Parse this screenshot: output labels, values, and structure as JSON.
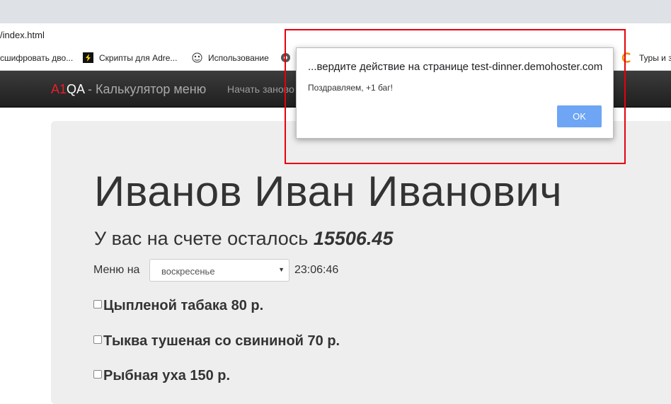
{
  "browser": {
    "url": "/index.html",
    "bookmarks": [
      {
        "label": "сшифровать дво..."
      },
      {
        "label": "Скрипты для Adre..."
      },
      {
        "label": "Использование"
      },
      {
        "label": "Туры и з"
      }
    ]
  },
  "navbar": {
    "brand_a1": "A1",
    "brand_qa": "QA",
    "brand_rest": " - Калькулятор меню",
    "link": "Начать заново"
  },
  "page": {
    "name": "Иванов Иван Иванович",
    "balance_label": "У вас на счете осталось ",
    "balance_value": "15506.45",
    "menu_label": "Меню на",
    "day_selected": "воскресенье",
    "clock": "23:06:46",
    "items": [
      {
        "label": "Цыпленой табака 80 р."
      },
      {
        "label": "Тыква тушеная со свининой 70 р."
      },
      {
        "label": "Рыбная уха 150 р."
      }
    ]
  },
  "dialog": {
    "title": "...вердите действие на странице test-dinner.demohoster.com",
    "message": "Поздравляем, +1 баг!",
    "ok_label": "OK"
  },
  "colors": {
    "brand_red": "#e8202a",
    "ok_button": "#6ea5f4",
    "highlight_box": "#e8000c"
  }
}
